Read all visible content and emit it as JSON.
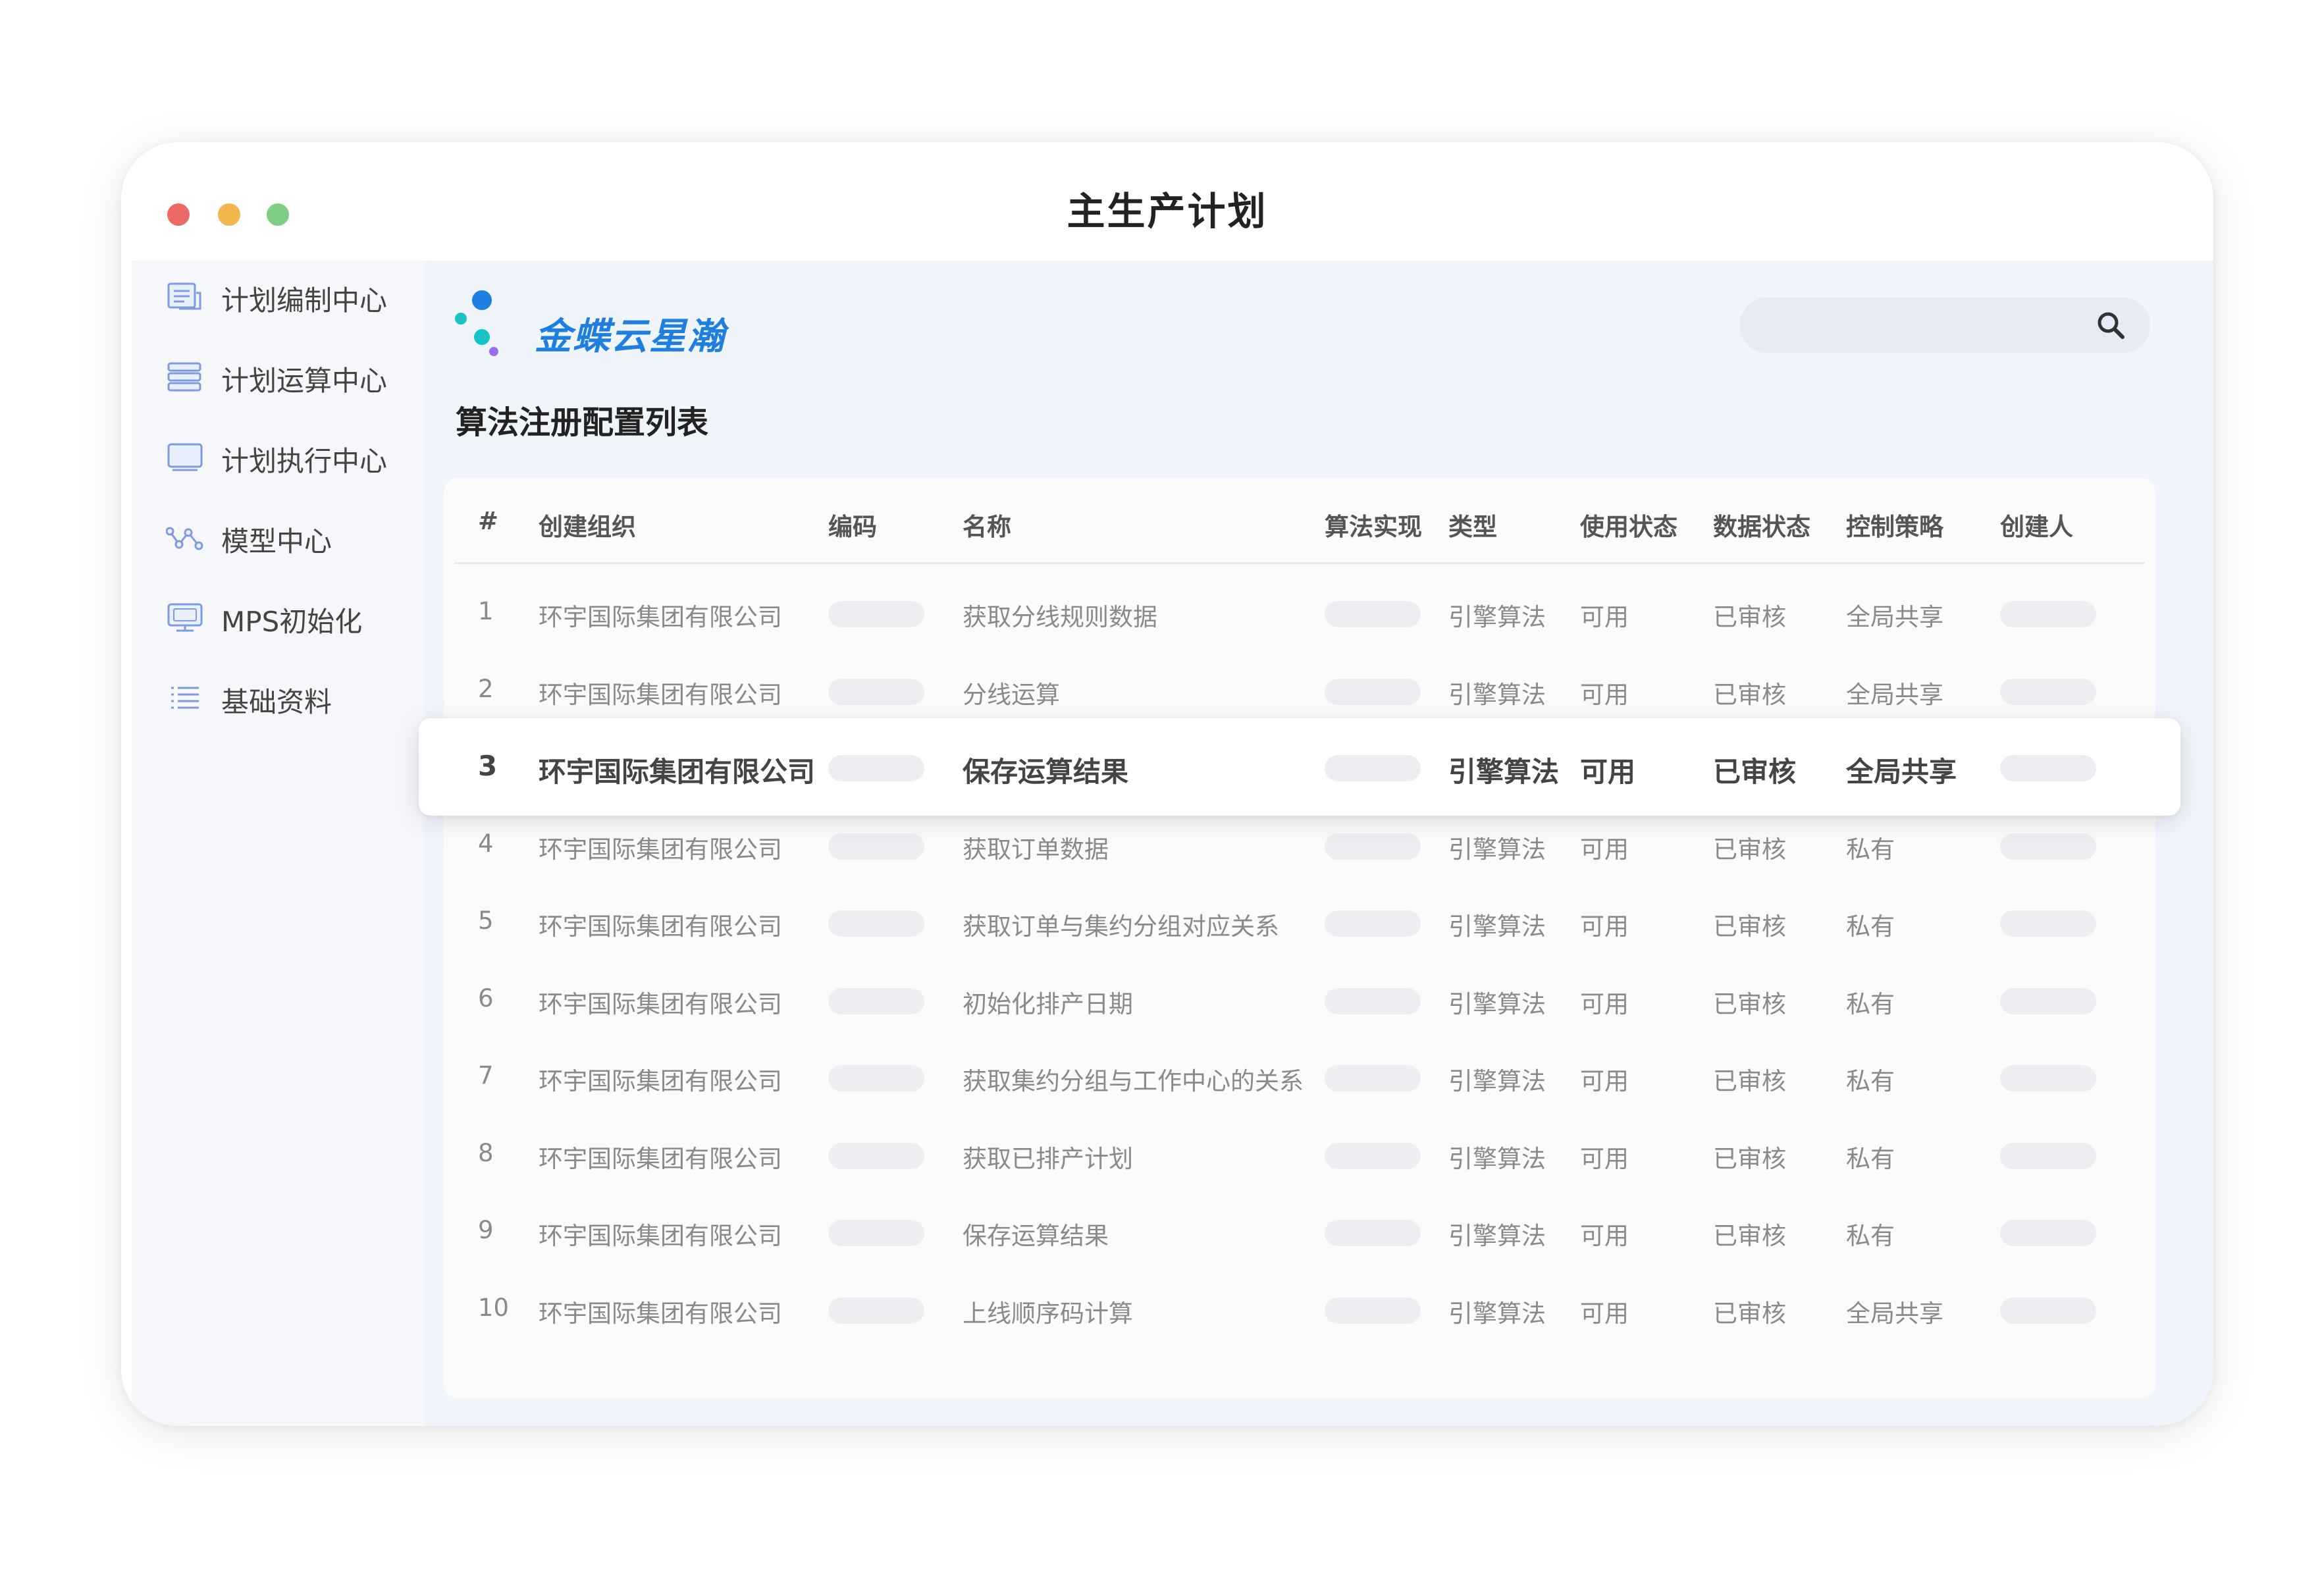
{
  "window": {
    "title": "主生产计划"
  },
  "sidebar": {
    "items": [
      {
        "label": "计划编制中心",
        "icon": "document-list-icon"
      },
      {
        "label": "计划运算中心",
        "icon": "server-stack-icon"
      },
      {
        "label": "计划执行中心",
        "icon": "monitor-icon"
      },
      {
        "label": "模型中心",
        "icon": "line-graph-icon"
      },
      {
        "label": "MPS初始化",
        "icon": "desktop-icon"
      },
      {
        "label": "基础资料",
        "icon": "list-icon"
      }
    ]
  },
  "header": {
    "logo_text": "金蝶云星瀚",
    "search_placeholder": ""
  },
  "main": {
    "title": "算法注册配置列表"
  },
  "table": {
    "columns": [
      "#",
      "创建组织",
      "编码",
      "名称",
      "算法实现",
      "类型",
      "使用状态",
      "数据状态",
      "控制策略",
      "创建人"
    ],
    "highlighted_row": 3,
    "rows": [
      {
        "no": "1",
        "org": "环宇国际集团有限公司",
        "name": "获取分线规则数据",
        "type": "引擎算法",
        "use_status": "可用",
        "data_status": "已审核",
        "policy": "全局共享"
      },
      {
        "no": "2",
        "org": "环宇国际集团有限公司",
        "name": "分线运算",
        "type": "引擎算法",
        "use_status": "可用",
        "data_status": "已审核",
        "policy": "全局共享"
      },
      {
        "no": "3",
        "org": "环宇国际集团有限公司",
        "name": "保存运算结果",
        "type": "引擎算法",
        "use_status": "可用",
        "data_status": "已审核",
        "policy": "全局共享"
      },
      {
        "no": "4",
        "org": "环宇国际集团有限公司",
        "name": "获取订单数据",
        "type": "引擎算法",
        "use_status": "可用",
        "data_status": "已审核",
        "policy": "私有"
      },
      {
        "no": "5",
        "org": "环宇国际集团有限公司",
        "name": "获取订单与集约分组对应关系",
        "type": "引擎算法",
        "use_status": "可用",
        "data_status": "已审核",
        "policy": "私有"
      },
      {
        "no": "6",
        "org": "环宇国际集团有限公司",
        "name": "初始化排产日期",
        "type": "引擎算法",
        "use_status": "可用",
        "data_status": "已审核",
        "policy": "私有"
      },
      {
        "no": "7",
        "org": "环宇国际集团有限公司",
        "name": "获取集约分组与工作中心的关系",
        "type": "引擎算法",
        "use_status": "可用",
        "data_status": "已审核",
        "policy": "私有"
      },
      {
        "no": "8",
        "org": "环宇国际集团有限公司",
        "name": "获取已排产计划",
        "type": "引擎算法",
        "use_status": "可用",
        "data_status": "已审核",
        "policy": "私有"
      },
      {
        "no": "9",
        "org": "环宇国际集团有限公司",
        "name": "保存运算结果",
        "type": "引擎算法",
        "use_status": "可用",
        "data_status": "已审核",
        "policy": "私有"
      },
      {
        "no": "10",
        "org": "环宇国际集团有限公司",
        "name": "上线顺序码计算",
        "type": "引擎算法",
        "use_status": "可用",
        "data_status": "已审核",
        "policy": "全局共享"
      }
    ]
  },
  "colors": {
    "accent": "#1f7fe0",
    "traffic_red": "#ec6a65",
    "traffic_yellow": "#f3b54d",
    "traffic_green": "#7fce84",
    "logo_dot_blue": "#1f7fe0",
    "logo_dot_cyan": "#17c2c9",
    "logo_dot_purple": "#9c6cf0"
  }
}
